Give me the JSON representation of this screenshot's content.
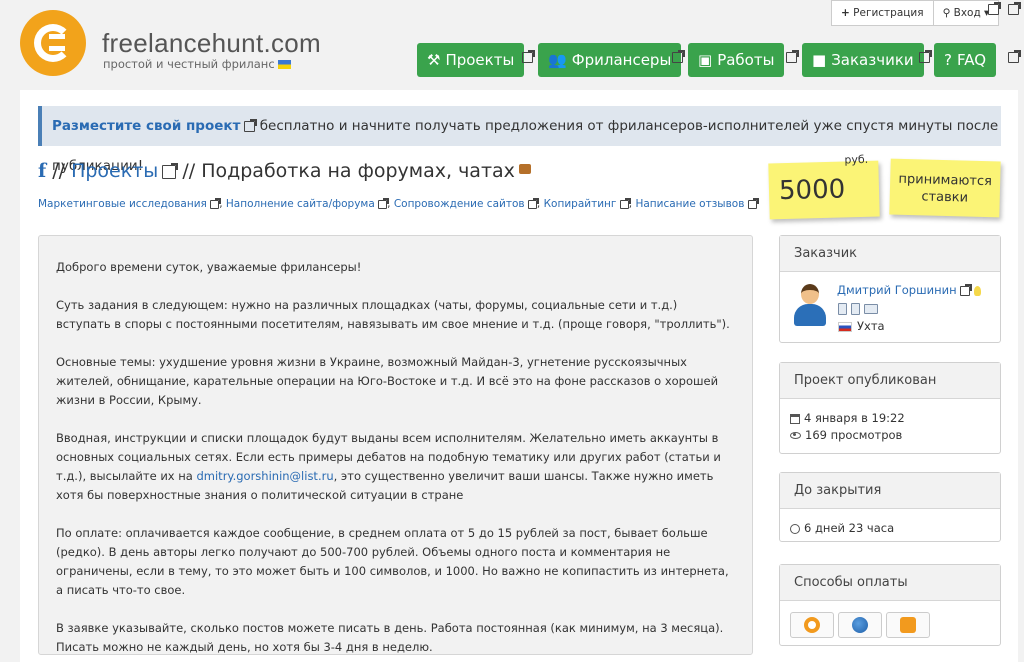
{
  "header": {
    "brand": "freelancehunt.com",
    "tagline": "простой и честный фриланс",
    "auth": {
      "register": "Регистрация",
      "login": "Вход"
    }
  },
  "nav": [
    {
      "label": "Проекты",
      "icon": "gavel-icon"
    },
    {
      "label": "Фрилансеры",
      "icon": "users-icon"
    },
    {
      "label": "Работы",
      "icon": "picture-icon"
    },
    {
      "label": "Заказчики",
      "icon": "briefcase-icon"
    },
    {
      "label": "FAQ",
      "icon": "question-icon"
    }
  ],
  "notice": {
    "link": "Разместите свой проект",
    "text": " бесплатно и начните получать предложения от фрилансеров-исполнителей уже спустя минуты после публикации!"
  },
  "breadcrumb": {
    "root": "f",
    "sep1": " // ",
    "section": "Проекты",
    "sep2": " // ",
    "title": "Подработка на форумах, чатах"
  },
  "tags": [
    "Маркетинговые исследования",
    "Наполнение сайта/форума",
    "Сопровождение сайтов",
    "Копирайтинг",
    "Написание отзывов"
  ],
  "budget": {
    "amount": "5000",
    "currency": "руб.",
    "bids_line1": "принимаются",
    "bids_line2": "ставки"
  },
  "description": {
    "p1": "Доброго времени суток, уважаемые фрилансеры!",
    "p2": "Суть задания в следующем: нужно на различных площадках (чаты, форумы, социальные сети и т.д.) вступать в споры с постоянными посетителям, навязывать им свое мнение и т.д. (проще говоря, \"троллить\").",
    "p3": "Основные темы: ухудшение уровня жизни в Украине, возможный Майдан-3, угнетение русскоязычных жителей, обнищание, карательные операции на Юго-Востоке и т.д. И всё это на фоне рассказов о хорошей жизни в России, Крыму.",
    "p4a": "Вводная, инструкции и списки площадок будут выданы всем исполнителям. Желательно иметь аккаунты в основных социальных сетях. Если есть примеры дебатов на подобную тематику или других работ (статьи и т.д.), высылайте их на ",
    "p4email": "dmitry.gorshinin@list.ru",
    "p4b": ", это существенно увеличит ваши шансы. Также нужно иметь хотя бы поверхностные знания о политической ситуации в стране",
    "p5": "По оплате: оплачивается каждое сообщение, в среднем оплата от 5 до 15 рублей за пост, бывает больше (редко). В день авторы легко получают до 500-700 рублей. Объемы одного поста и комментария не ограничены, если в тему, то это может быть и 100 символов, и 1000. Но важно не копипастить из интернета, а писать что-то свое.",
    "p6": "В заявке указывайте, сколько постов можете писать в день. Работа постоянная (как минимум, на 3 месяца). Писать можно не каждый день, но хотя бы 3-4 дня в неделю."
  },
  "client": {
    "heading": "Заказчик",
    "name": "Дмитрий Горшинин",
    "city": "Ухта"
  },
  "published": {
    "heading": "Проект опубликован",
    "date": "4 января в 19:22",
    "views": "169 просмотров"
  },
  "closing": {
    "heading": "До закрытия",
    "remaining": "6 дней 23 часа"
  },
  "payment": {
    "heading": "Способы оплаты",
    "methods": [
      "qiwi-icon",
      "webmoney-icon",
      "yandex-money-icon"
    ]
  },
  "colors": {
    "nav_green": "#3aa34c",
    "link_blue": "#2a6bb3",
    "sticker_yellow": "#fbf476",
    "logo_orange": "#f2a31b"
  }
}
